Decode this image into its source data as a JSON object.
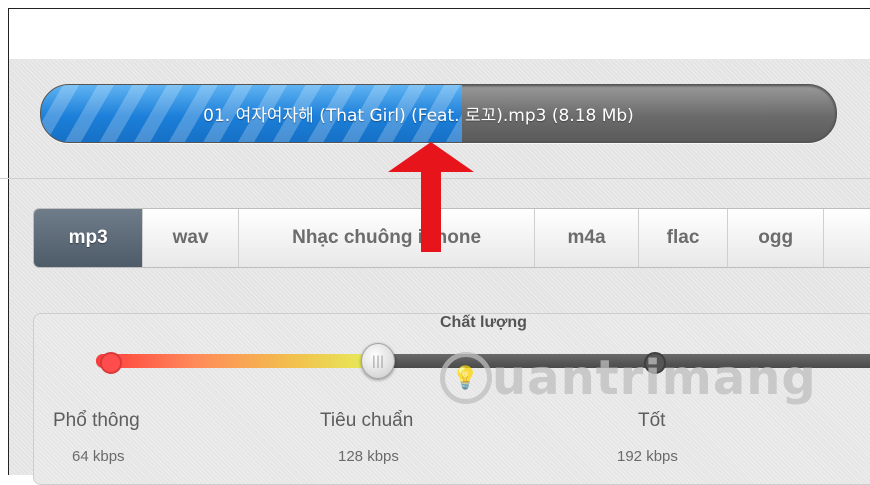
{
  "file": {
    "name": "01. 여자여자해 (That Girl) (Feat. 로꼬).mp3 (8.18 Mb)",
    "upload_progress_pct": 53
  },
  "formats": {
    "tabs": [
      {
        "label": "mp3",
        "active": true
      },
      {
        "label": "wav",
        "active": false
      },
      {
        "label": "Nhạc chuông iPhone",
        "active": false
      },
      {
        "label": "m4a",
        "active": false
      },
      {
        "label": "flac",
        "active": false
      },
      {
        "label": "ogg",
        "active": false
      }
    ]
  },
  "quality": {
    "title": "Chất lượng",
    "selected_index": 1,
    "levels": [
      {
        "label": "Phổ thông",
        "bitrate": "64 kbps"
      },
      {
        "label": "Tiêu chuẩn",
        "bitrate": "128 kbps"
      },
      {
        "label": "Tốt",
        "bitrate": "192 kbps"
      }
    ]
  },
  "watermark": {
    "text": "uantrimang",
    "icon": "lightbulb-icon"
  },
  "colors": {
    "progress_blue": "#1c7fd9",
    "arrow_red": "#e8141b",
    "active_tab": "#5a6776"
  }
}
